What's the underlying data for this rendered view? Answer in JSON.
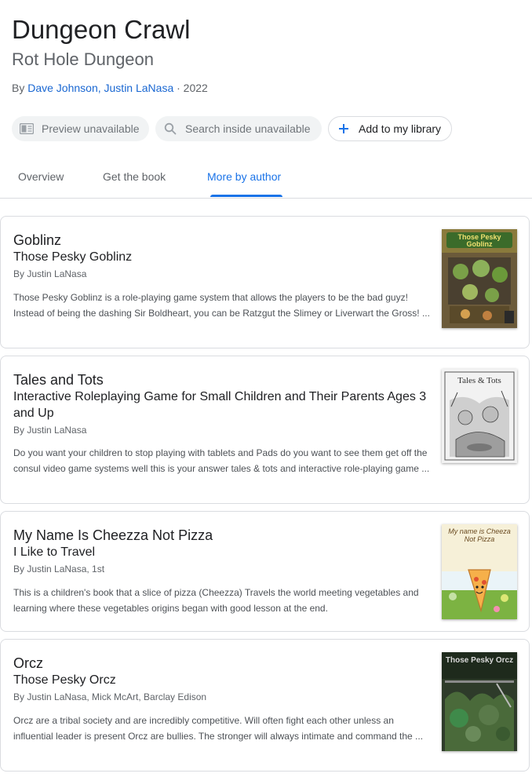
{
  "book": {
    "title": "Dungeon Crawl",
    "subtitle": "Rot Hole Dungeon",
    "by_prefix": "By ",
    "authors_link": "Dave Johnson, Justin LaNasa",
    "year_suffix": " · 2022"
  },
  "actions": {
    "preview": "Preview unavailable",
    "search_inside": "Search inside unavailable",
    "add_library": "Add to my library"
  },
  "tabs": {
    "overview": "Overview",
    "get_book": "Get the book",
    "more_by_author": "More by author"
  },
  "accent_color": "#1a73e8",
  "results": [
    {
      "title": "Goblinz",
      "subtitle": "Those Pesky Goblinz",
      "byline": "By Justin LaNasa",
      "description": "Those Pesky Goblinz is a role-playing game system that allows the players to be the bad guyz! Instead of being the dashing Sir Boldheart, you can be Ratzgut the Slimey or Liverwart the Gross! ...",
      "cover_text": "Those Pesky Goblinz"
    },
    {
      "title": "Tales and Tots",
      "subtitle": "Interactive Roleplaying Game for Small Children and Their Parents Ages 3 and Up",
      "byline": "By Justin LaNasa",
      "description": "Do you want your children to stop playing with tablets and Pads do you want to see them get off the consul video game systems well this is your answer tales & tots and interactive role-playing game ...",
      "cover_text": "Tales & Tots"
    },
    {
      "title": "My Name Is Cheezza Not Pizza",
      "subtitle": "I Like to Travel",
      "byline": "By Justin LaNasa, 1st",
      "description": "This is a children's book that a slice of pizza (Cheezza) Travels the world meeting vegetables and learning where these vegetables origins began with good lesson at the end.",
      "cover_text": "My name is Cheeza Not Pizza"
    },
    {
      "title": "Orcz",
      "subtitle": "Those Pesky Orcz",
      "byline": "By Justin LaNasa, Mick McArt, Barclay Edison",
      "description": "Orcz are a tribal society and are incredibly competitive. Will often fight each other unless an influential leader is present Orcz are bullies. The stronger will always intimate and command the ...",
      "cover_text": "Those Pesky Orcz"
    }
  ]
}
